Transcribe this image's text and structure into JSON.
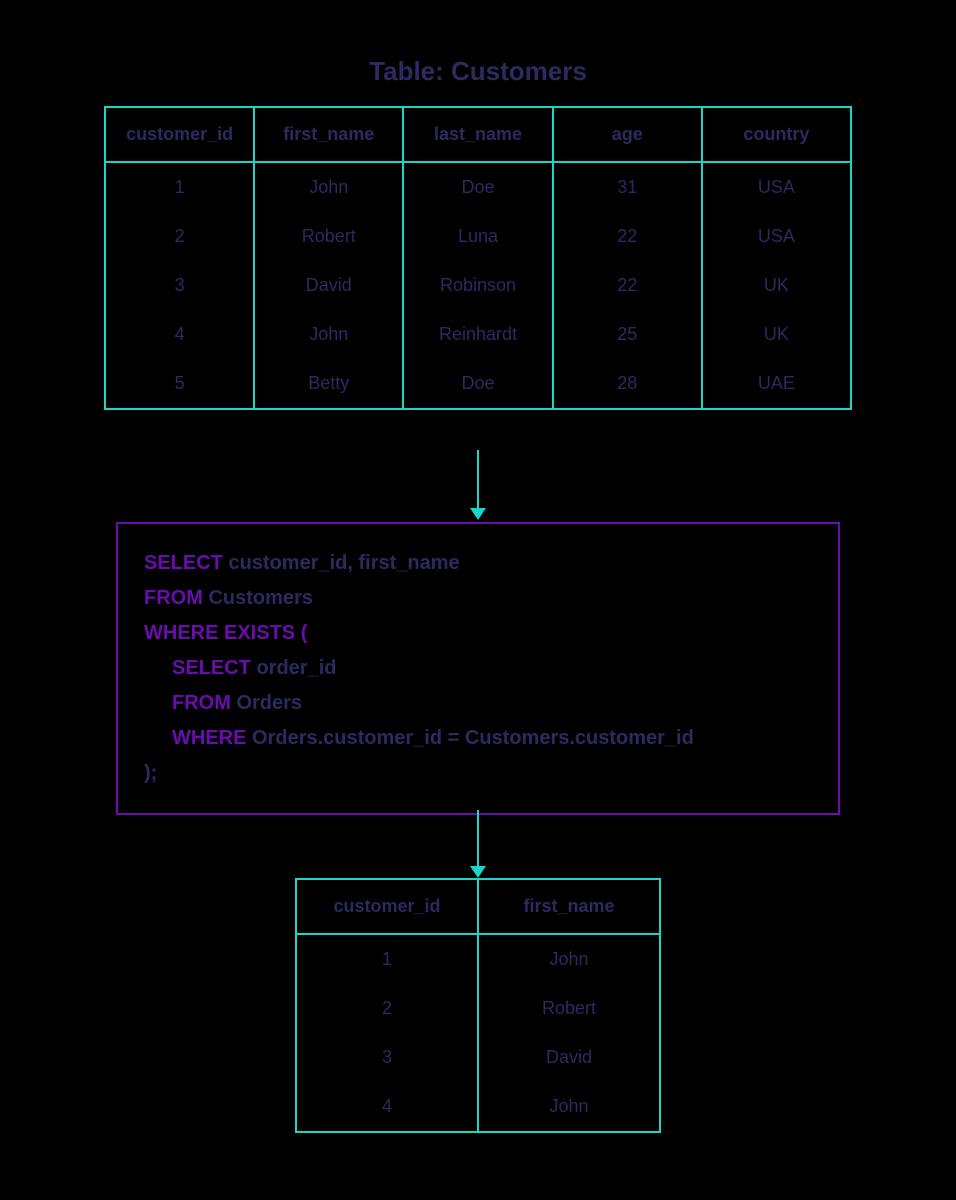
{
  "title": "Table: Customers",
  "customers": {
    "headers": [
      "customer_id",
      "first_name",
      "last_name",
      "age",
      "country"
    ],
    "rows": [
      [
        "1",
        "John",
        "Doe",
        "31",
        "USA"
      ],
      [
        "2",
        "Robert",
        "Luna",
        "22",
        "USA"
      ],
      [
        "3",
        "David",
        "Robinson",
        "22",
        "UK"
      ],
      [
        "4",
        "John",
        "Reinhardt",
        "25",
        "UK"
      ],
      [
        "5",
        "Betty",
        "Doe",
        "28",
        "UAE"
      ]
    ]
  },
  "sql": {
    "kw_select": "SELECT",
    "kw_from": "FROM",
    "kw_where_exists": "WHERE EXISTS (",
    "kw_where": "WHERE",
    "select_cols": " customer_id, first_name",
    "from_tbl": " Customers",
    "inner_select_cols": " order_id",
    "inner_from_tbl": " Orders",
    "inner_where_cond": "  Orders.customer_id = Customers.customer_id",
    "close": ");"
  },
  "result": {
    "headers": [
      "customer_id",
      "first_name"
    ],
    "rows": [
      [
        "1",
        "John"
      ],
      [
        "2",
        "Robert"
      ],
      [
        "3",
        "David"
      ],
      [
        "4",
        "John"
      ]
    ]
  }
}
